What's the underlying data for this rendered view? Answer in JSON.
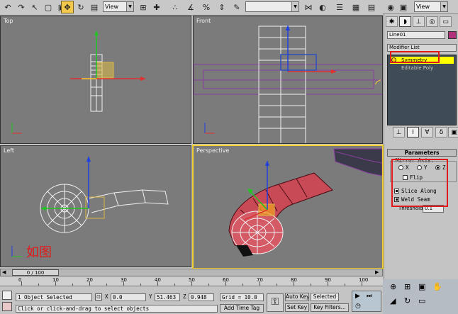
{
  "toolbar": {
    "view_dropdown_1": "View",
    "view_dropdown_2": "View",
    "named_selection": ""
  },
  "viewports": {
    "top": "Top",
    "front": "Front",
    "left": "Left",
    "perspective": "Perspective",
    "annotation": "如图"
  },
  "panel": {
    "object_name": "Line01",
    "modifier_list": "Modifier List",
    "stack_items": [
      "Symmetry",
      "Editable Poly"
    ],
    "parameters_title": "Parameters",
    "mirror_axis_label": "Mirror Axis:",
    "axis_x": "X",
    "axis_y": "Y",
    "axis_z": "Z",
    "axis_selected": "Z",
    "flip_label": "Flip",
    "slice_along_label": "Slice Along",
    "weld_seam_label": "Weld Seam",
    "threshold_label": "Threshold",
    "threshold_value": "0.1",
    "colors": {
      "highlight": "#ffff00",
      "annotation_red": "#e01a1a",
      "active_viewport": "#f3d034"
    }
  },
  "timeline": {
    "slider": "0 / 100",
    "ticks": [
      "0",
      "10",
      "20",
      "30",
      "40",
      "50",
      "60",
      "70",
      "80",
      "90",
      "100"
    ]
  },
  "status": {
    "selection": "1 Object Selected",
    "prompt": "Click or click-and-drag to select objects",
    "x_label": "X",
    "x_value": "0.0",
    "y_label": "Y",
    "y_value": "51.463",
    "z_label": "Z",
    "z_value": "0.948",
    "grid": "Grid = 10.0",
    "add_time_tag": "Add Time Tag",
    "auto_key": "Auto Key",
    "auto_key_mode": "Selected",
    "set_key": "Set Key",
    "key_filters": "Key Filters..."
  }
}
